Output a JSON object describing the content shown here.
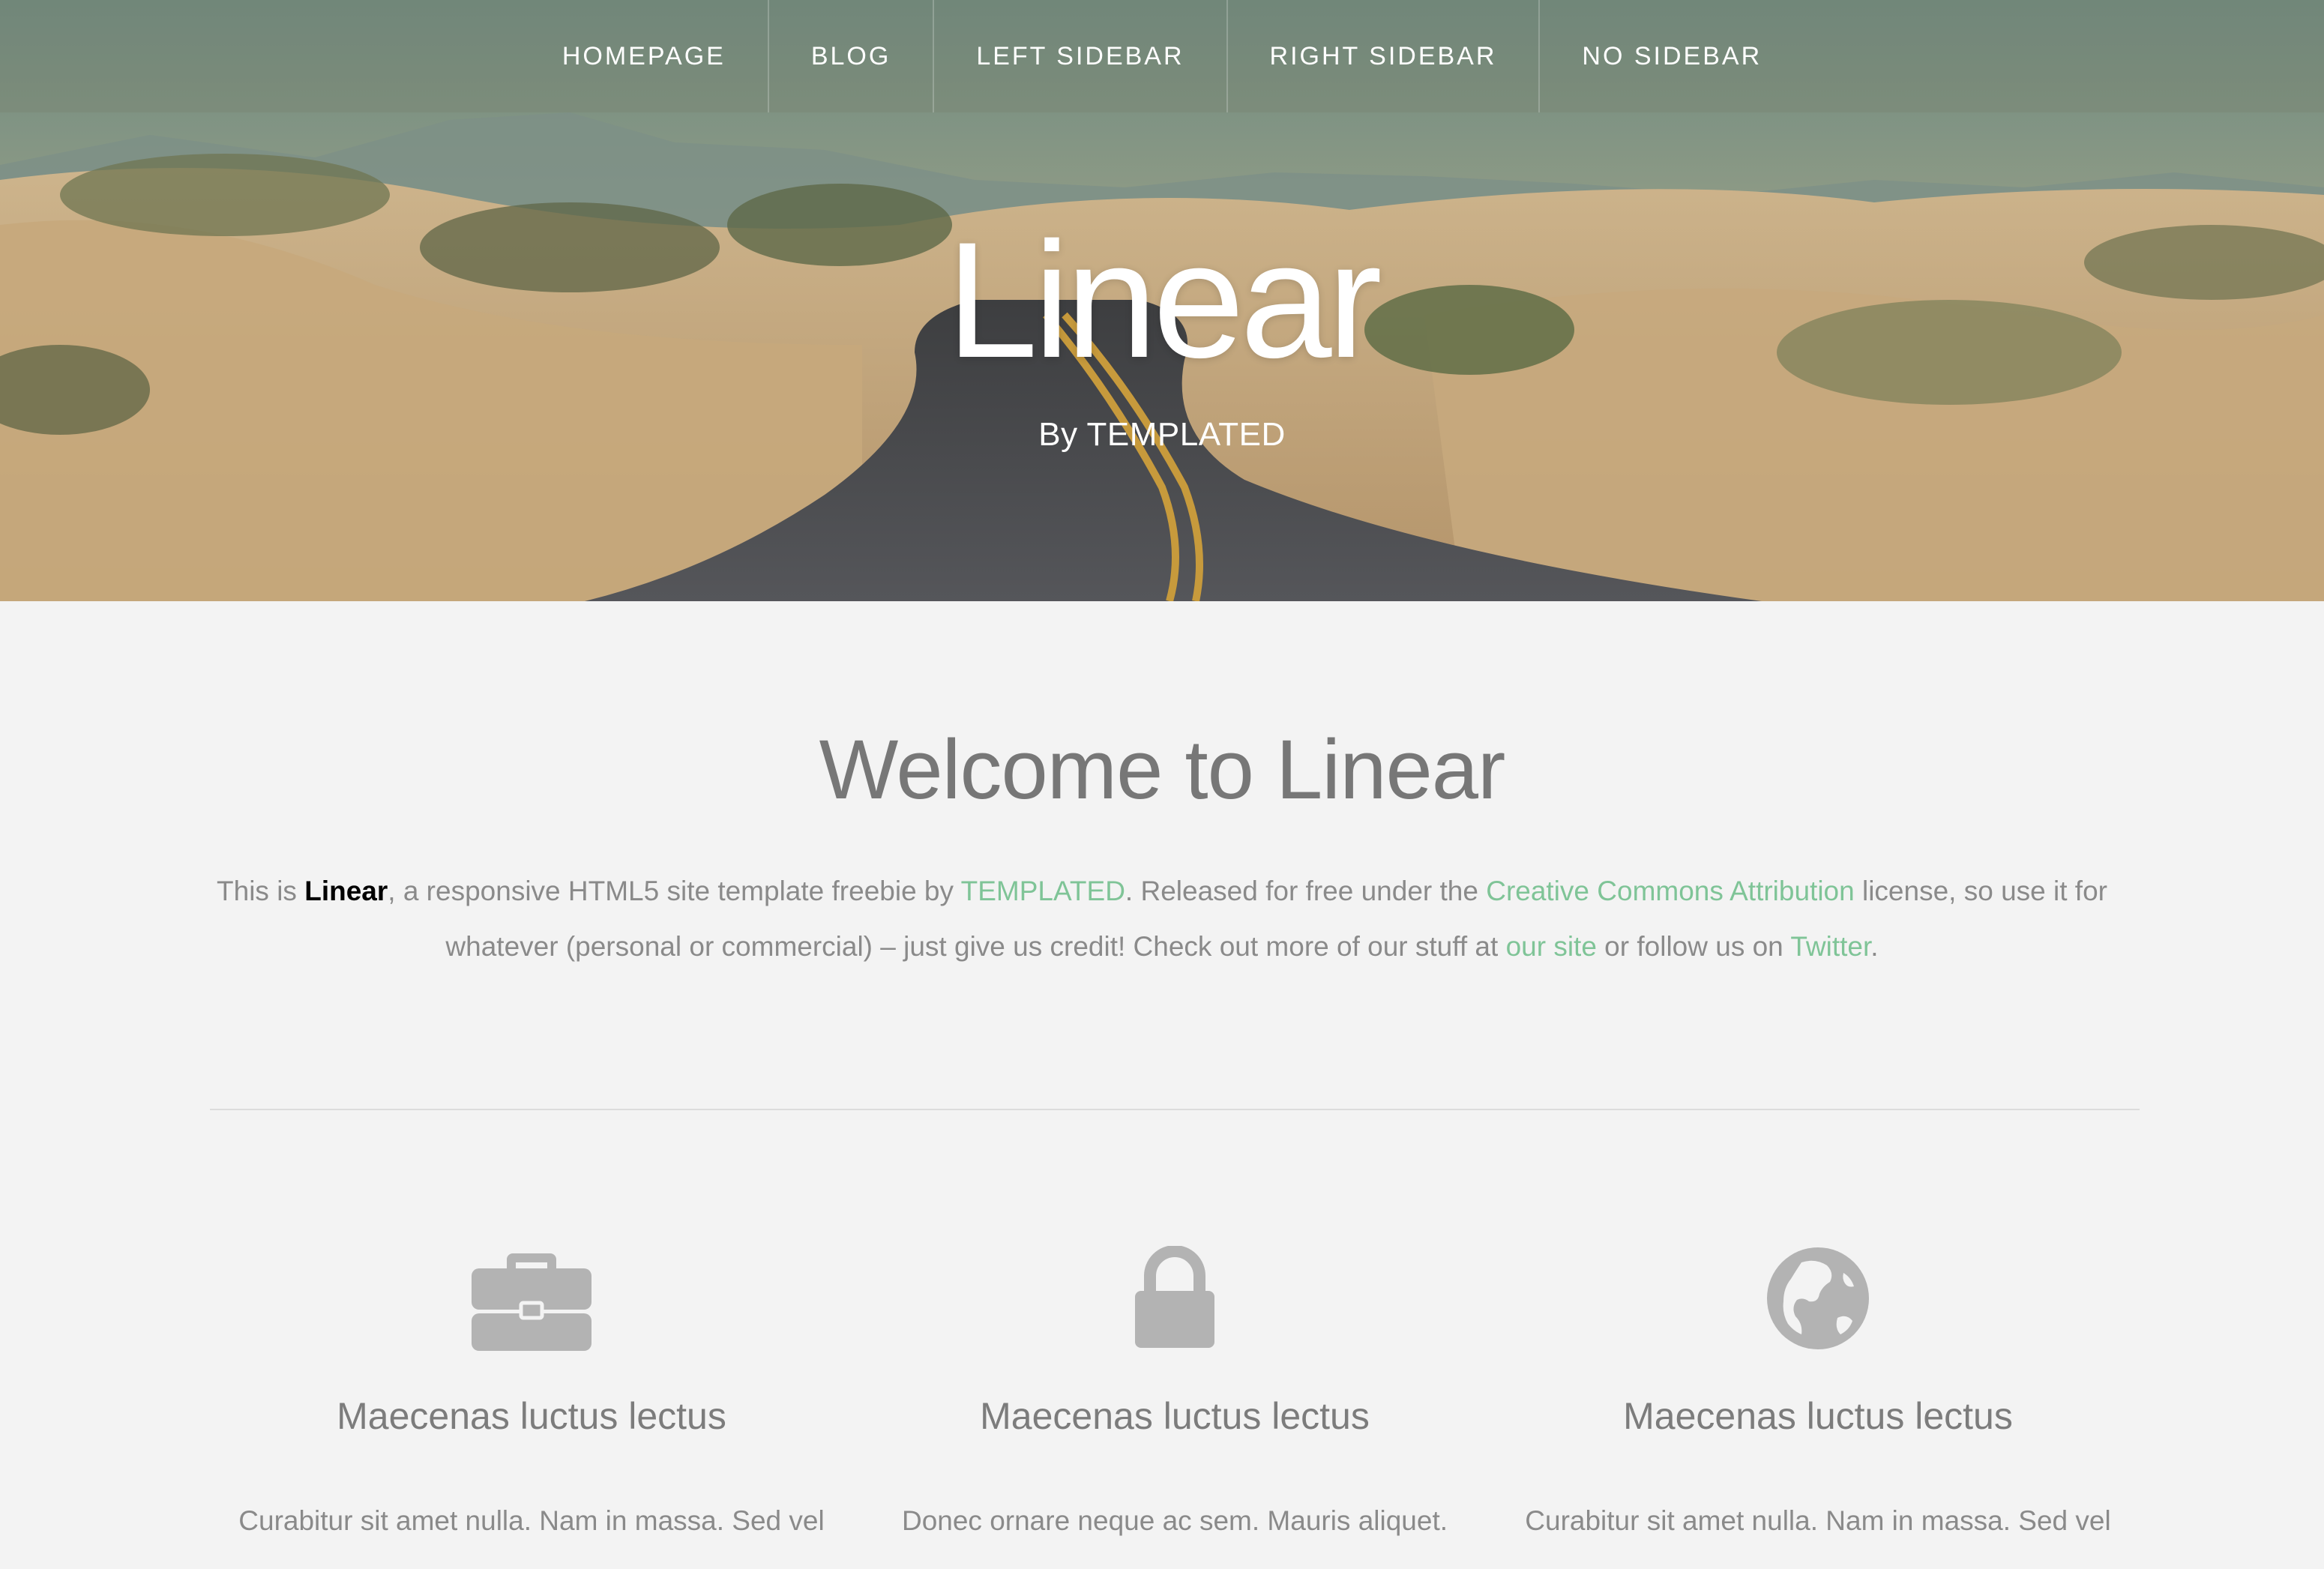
{
  "nav": {
    "items": [
      {
        "label": "HOMEPAGE"
      },
      {
        "label": "BLOG"
      },
      {
        "label": "LEFT SIDEBAR"
      },
      {
        "label": "RIGHT SIDEBAR"
      },
      {
        "label": "NO SIDEBAR"
      }
    ]
  },
  "hero": {
    "title": "Linear",
    "subtitle": "By TEMPLATED"
  },
  "welcome": {
    "title": "Welcome to Linear",
    "intro": {
      "t1": "This is ",
      "brand": "Linear",
      "t2": ", a responsive HTML5 site template freebie by ",
      "link_templated": "TEMPLATED",
      "t3": ". Released for free under the ",
      "link_license": "Creative Commons Attribution",
      "t4": " license, so use it for whatever (personal or commercial) – just give us credit! Check out more of our stuff at ",
      "link_site": "our site",
      "t5": " or follow us on ",
      "link_twitter": "Twitter",
      "t6": "."
    }
  },
  "features": [
    {
      "icon": "briefcase-icon",
      "title": "Maecenas luctus lectus",
      "text": "Curabitur sit amet nulla. Nam in massa. Sed vel"
    },
    {
      "icon": "lock-icon",
      "title": "Maecenas luctus lectus",
      "text": "Donec ornare neque ac sem. Mauris aliquet."
    },
    {
      "icon": "globe-icon",
      "title": "Maecenas luctus lectus",
      "text": "Curabitur sit amet nulla. Nam in massa. Sed vel"
    }
  ],
  "colors": {
    "accent": "#7fc497",
    "icon": "#b3b3b3",
    "background": "#f3f3f3"
  }
}
